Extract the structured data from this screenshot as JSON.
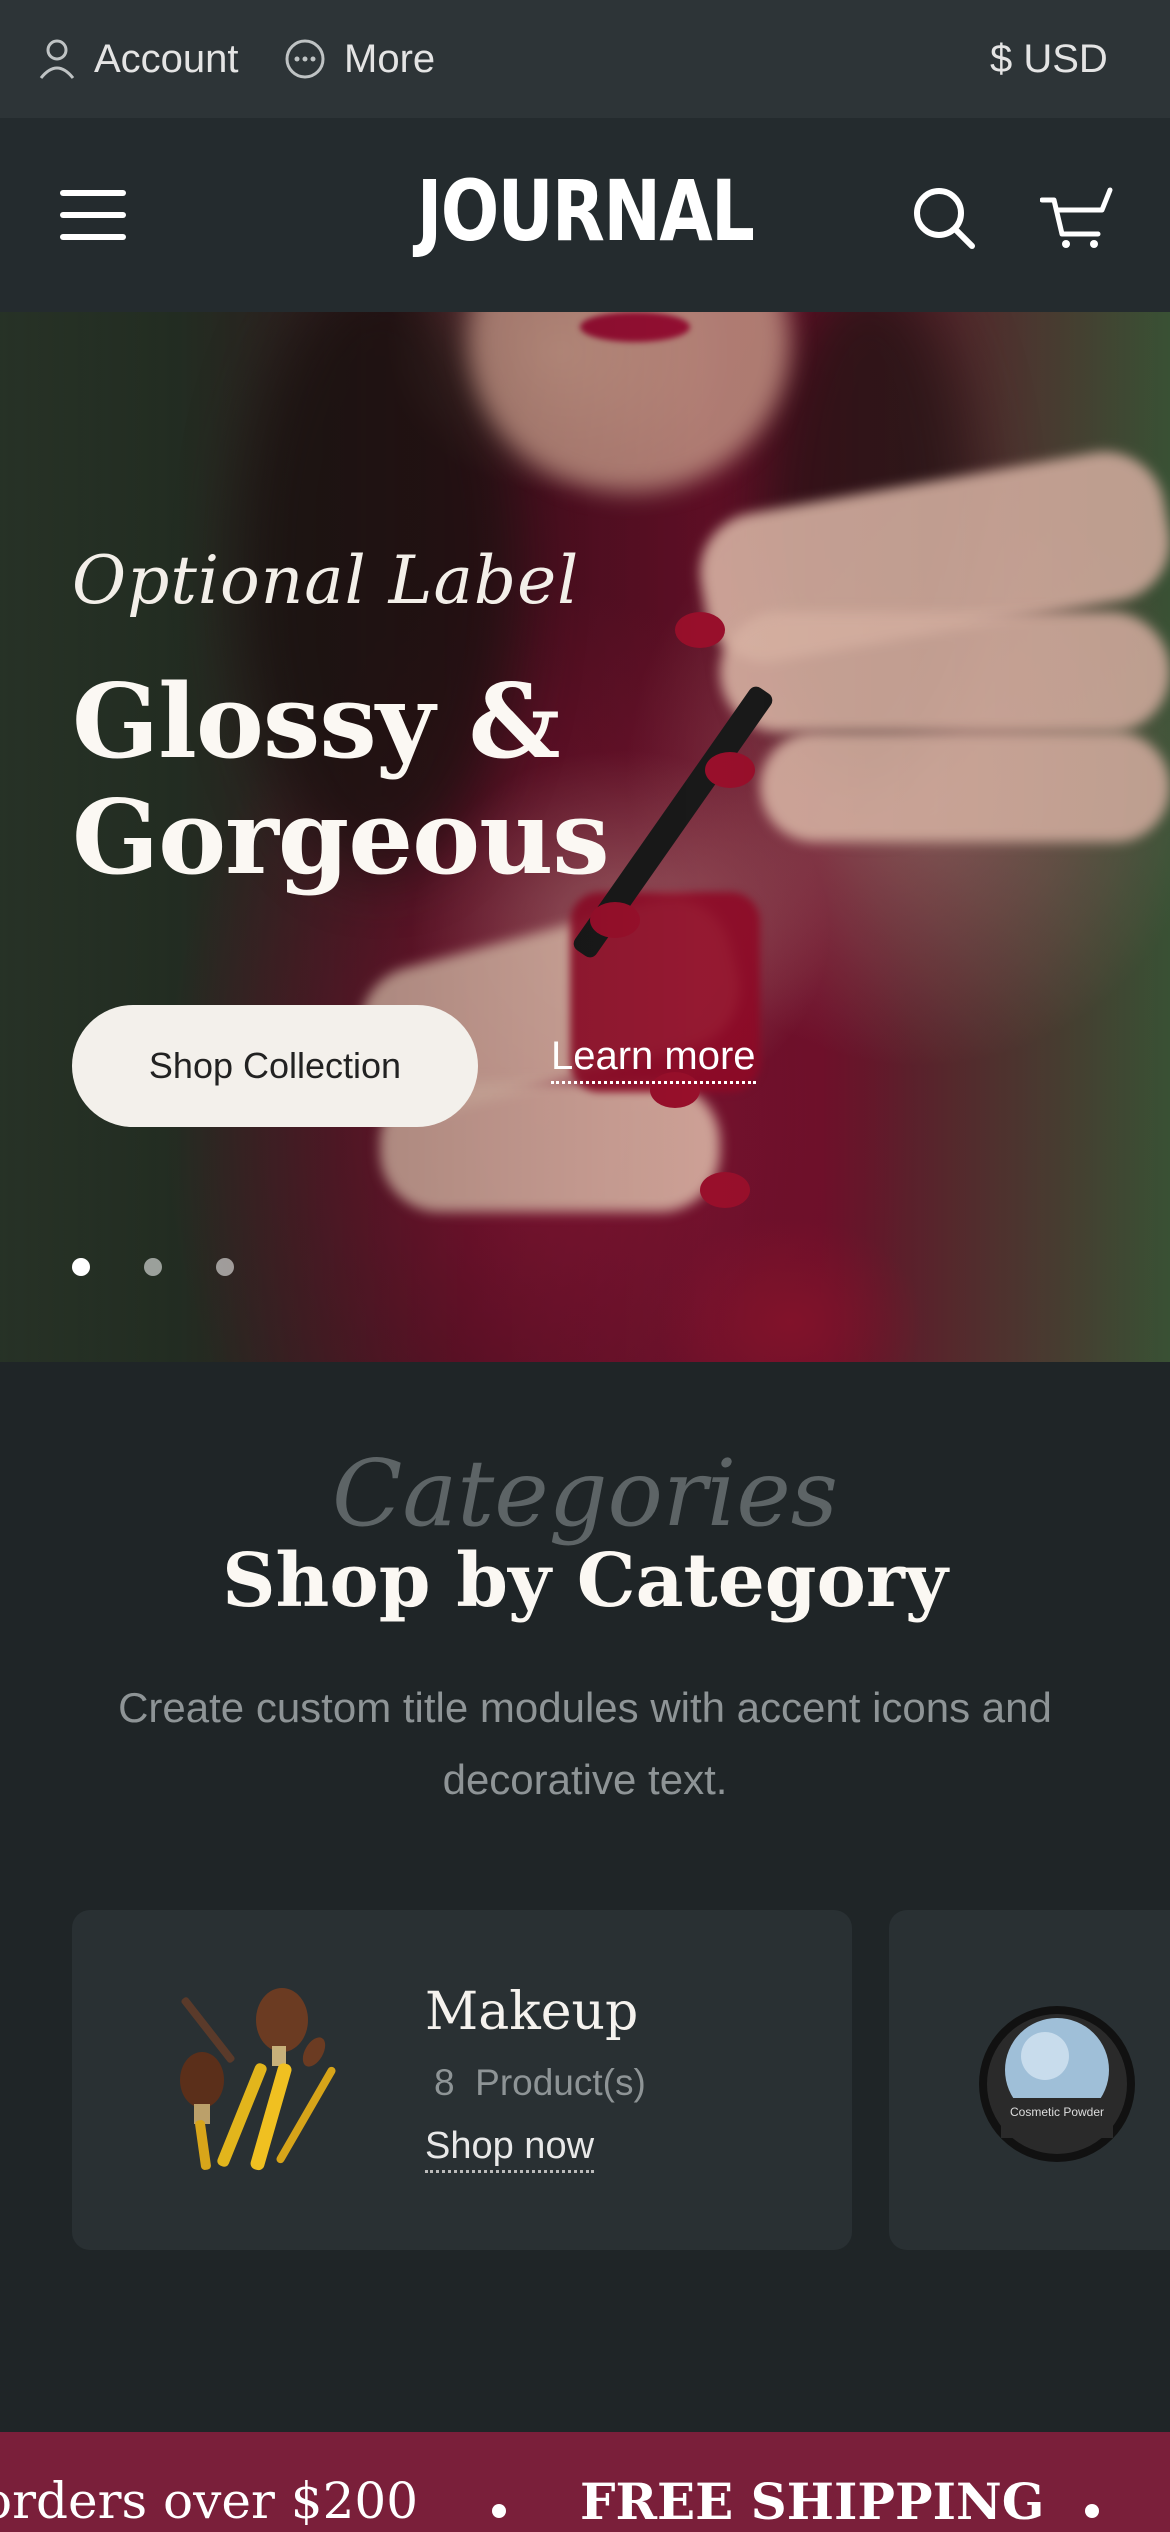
{
  "topbar": {
    "account_label": "Account",
    "more_label": "More",
    "currency_label": "$ USD"
  },
  "header": {
    "logo_text": "JOURNAL",
    "icons": [
      "menu-icon",
      "search-icon",
      "cart-icon"
    ]
  },
  "hero": {
    "optional_label": "Optional Label",
    "title_line1": "Glossy &",
    "title_line2": "Gorgeous",
    "primary_button": "Shop Collection",
    "secondary_link": "Learn more",
    "slides_count": 3,
    "active_slide": 1
  },
  "categories": {
    "accent": "Categories",
    "title": "Shop by Category",
    "subtitle": "Create custom title modules with accent icons and decorative text.",
    "items": [
      {
        "name": "Makeup",
        "count": "8",
        "count_suffix": "Product(s)",
        "link": "Shop now",
        "image": "makeup-brushes"
      },
      {
        "name": "",
        "count": "",
        "count_suffix": "",
        "link": "",
        "image": "cosmetic-powder",
        "image_text": "Cosmetic Powder"
      }
    ]
  },
  "marquee": {
    "segment_1": "orders over $200",
    "segment_2": "FREE SHIPPING"
  },
  "colors": {
    "topbar_bg": "#2d3437",
    "header_bg": "#242b2e",
    "page_bg": "#1f2527",
    "card_bg": "#293033",
    "marquee_bg": "#7a1f3a"
  }
}
